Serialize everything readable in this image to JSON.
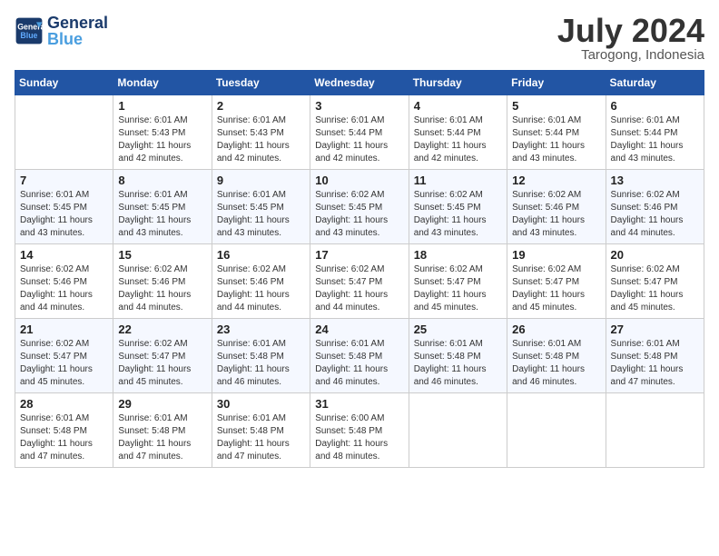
{
  "header": {
    "logo_line1": "General",
    "logo_line2": "Blue",
    "month": "July 2024",
    "location": "Tarogong, Indonesia"
  },
  "weekdays": [
    "Sunday",
    "Monday",
    "Tuesday",
    "Wednesday",
    "Thursday",
    "Friday",
    "Saturday"
  ],
  "weeks": [
    [
      {
        "day": "",
        "info": ""
      },
      {
        "day": "1",
        "info": "Sunrise: 6:01 AM\nSunset: 5:43 PM\nDaylight: 11 hours\nand 42 minutes."
      },
      {
        "day": "2",
        "info": "Sunrise: 6:01 AM\nSunset: 5:43 PM\nDaylight: 11 hours\nand 42 minutes."
      },
      {
        "day": "3",
        "info": "Sunrise: 6:01 AM\nSunset: 5:44 PM\nDaylight: 11 hours\nand 42 minutes."
      },
      {
        "day": "4",
        "info": "Sunrise: 6:01 AM\nSunset: 5:44 PM\nDaylight: 11 hours\nand 42 minutes."
      },
      {
        "day": "5",
        "info": "Sunrise: 6:01 AM\nSunset: 5:44 PM\nDaylight: 11 hours\nand 43 minutes."
      },
      {
        "day": "6",
        "info": "Sunrise: 6:01 AM\nSunset: 5:44 PM\nDaylight: 11 hours\nand 43 minutes."
      }
    ],
    [
      {
        "day": "7",
        "info": "Sunrise: 6:01 AM\nSunset: 5:45 PM\nDaylight: 11 hours\nand 43 minutes."
      },
      {
        "day": "8",
        "info": "Sunrise: 6:01 AM\nSunset: 5:45 PM\nDaylight: 11 hours\nand 43 minutes."
      },
      {
        "day": "9",
        "info": "Sunrise: 6:01 AM\nSunset: 5:45 PM\nDaylight: 11 hours\nand 43 minutes."
      },
      {
        "day": "10",
        "info": "Sunrise: 6:02 AM\nSunset: 5:45 PM\nDaylight: 11 hours\nand 43 minutes."
      },
      {
        "day": "11",
        "info": "Sunrise: 6:02 AM\nSunset: 5:45 PM\nDaylight: 11 hours\nand 43 minutes."
      },
      {
        "day": "12",
        "info": "Sunrise: 6:02 AM\nSunset: 5:46 PM\nDaylight: 11 hours\nand 43 minutes."
      },
      {
        "day": "13",
        "info": "Sunrise: 6:02 AM\nSunset: 5:46 PM\nDaylight: 11 hours\nand 44 minutes."
      }
    ],
    [
      {
        "day": "14",
        "info": "Sunrise: 6:02 AM\nSunset: 5:46 PM\nDaylight: 11 hours\nand 44 minutes."
      },
      {
        "day": "15",
        "info": "Sunrise: 6:02 AM\nSunset: 5:46 PM\nDaylight: 11 hours\nand 44 minutes."
      },
      {
        "day": "16",
        "info": "Sunrise: 6:02 AM\nSunset: 5:46 PM\nDaylight: 11 hours\nand 44 minutes."
      },
      {
        "day": "17",
        "info": "Sunrise: 6:02 AM\nSunset: 5:47 PM\nDaylight: 11 hours\nand 44 minutes."
      },
      {
        "day": "18",
        "info": "Sunrise: 6:02 AM\nSunset: 5:47 PM\nDaylight: 11 hours\nand 45 minutes."
      },
      {
        "day": "19",
        "info": "Sunrise: 6:02 AM\nSunset: 5:47 PM\nDaylight: 11 hours\nand 45 minutes."
      },
      {
        "day": "20",
        "info": "Sunrise: 6:02 AM\nSunset: 5:47 PM\nDaylight: 11 hours\nand 45 minutes."
      }
    ],
    [
      {
        "day": "21",
        "info": "Sunrise: 6:02 AM\nSunset: 5:47 PM\nDaylight: 11 hours\nand 45 minutes."
      },
      {
        "day": "22",
        "info": "Sunrise: 6:02 AM\nSunset: 5:47 PM\nDaylight: 11 hours\nand 45 minutes."
      },
      {
        "day": "23",
        "info": "Sunrise: 6:01 AM\nSunset: 5:48 PM\nDaylight: 11 hours\nand 46 minutes."
      },
      {
        "day": "24",
        "info": "Sunrise: 6:01 AM\nSunset: 5:48 PM\nDaylight: 11 hours\nand 46 minutes."
      },
      {
        "day": "25",
        "info": "Sunrise: 6:01 AM\nSunset: 5:48 PM\nDaylight: 11 hours\nand 46 minutes."
      },
      {
        "day": "26",
        "info": "Sunrise: 6:01 AM\nSunset: 5:48 PM\nDaylight: 11 hours\nand 46 minutes."
      },
      {
        "day": "27",
        "info": "Sunrise: 6:01 AM\nSunset: 5:48 PM\nDaylight: 11 hours\nand 47 minutes."
      }
    ],
    [
      {
        "day": "28",
        "info": "Sunrise: 6:01 AM\nSunset: 5:48 PM\nDaylight: 11 hours\nand 47 minutes."
      },
      {
        "day": "29",
        "info": "Sunrise: 6:01 AM\nSunset: 5:48 PM\nDaylight: 11 hours\nand 47 minutes."
      },
      {
        "day": "30",
        "info": "Sunrise: 6:01 AM\nSunset: 5:48 PM\nDaylight: 11 hours\nand 47 minutes."
      },
      {
        "day": "31",
        "info": "Sunrise: 6:00 AM\nSunset: 5:48 PM\nDaylight: 11 hours\nand 48 minutes."
      },
      {
        "day": "",
        "info": ""
      },
      {
        "day": "",
        "info": ""
      },
      {
        "day": "",
        "info": ""
      }
    ]
  ]
}
